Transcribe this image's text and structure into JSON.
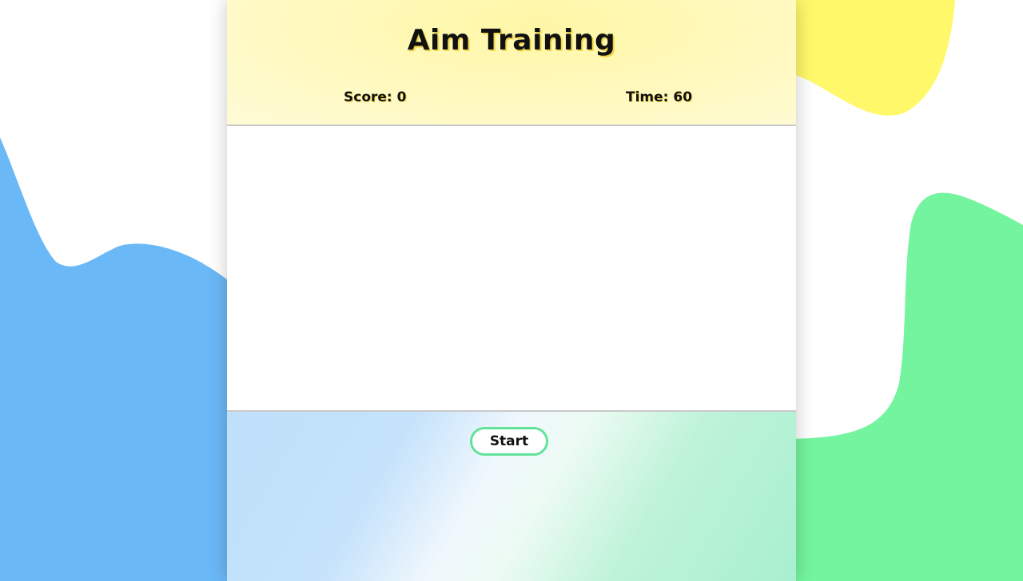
{
  "game": {
    "title": "Aim Training",
    "score_label": "Score",
    "score_value": "0",
    "time_label": "Time",
    "time_value": "60",
    "start_label": "Start"
  },
  "colors": {
    "blue_blob": "#6bb8f6",
    "green_blob": "#74f49f",
    "yellow_blob": "#fff86a",
    "button_border": "#62e39a",
    "header_bg": "#fff8b8"
  }
}
